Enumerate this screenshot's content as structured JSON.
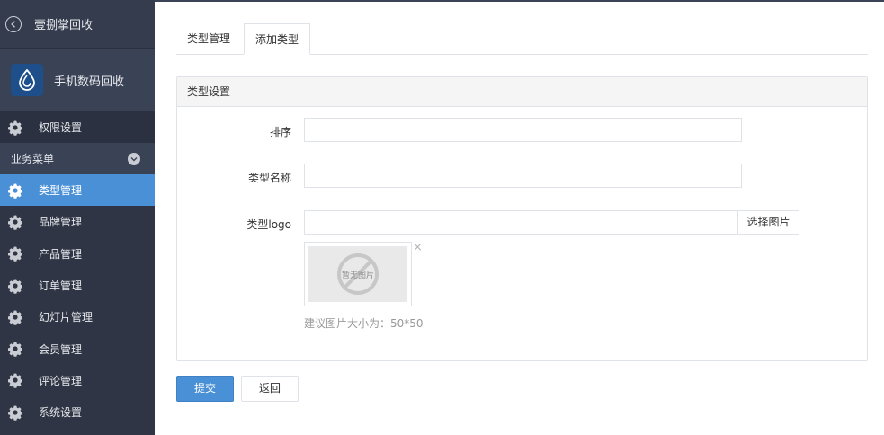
{
  "sidebar": {
    "back_title": "壹捌掌回收",
    "app_name": "手机数码回收",
    "permission_label": "权限设置",
    "section_label": "业务菜单",
    "items": [
      {
        "label": "类型管理",
        "active": true
      },
      {
        "label": "品牌管理"
      },
      {
        "label": "产品管理"
      },
      {
        "label": "订单管理"
      },
      {
        "label": "幻灯片管理"
      },
      {
        "label": "会员管理"
      },
      {
        "label": "评论管理"
      },
      {
        "label": "系统设置"
      }
    ]
  },
  "tabs": [
    {
      "label": "类型管理"
    },
    {
      "label": "添加类型",
      "active": true
    }
  ],
  "form": {
    "panel_title": "类型设置",
    "sort_label": "排序",
    "sort_value": "",
    "name_label": "类型名称",
    "name_value": "",
    "logo_label": "类型logo",
    "logo_value": "",
    "pick_button": "选择图片",
    "thumb_placeholder": "暂无图片",
    "thumb_close": "×",
    "hint": "建议图片大小为：50*50"
  },
  "actions": {
    "submit_label": "提交",
    "back_label": "返回"
  },
  "colors": {
    "sidebar_bg": "#2f3544",
    "active_item": "#4a90d6",
    "primary_button": "#4a90d6"
  }
}
